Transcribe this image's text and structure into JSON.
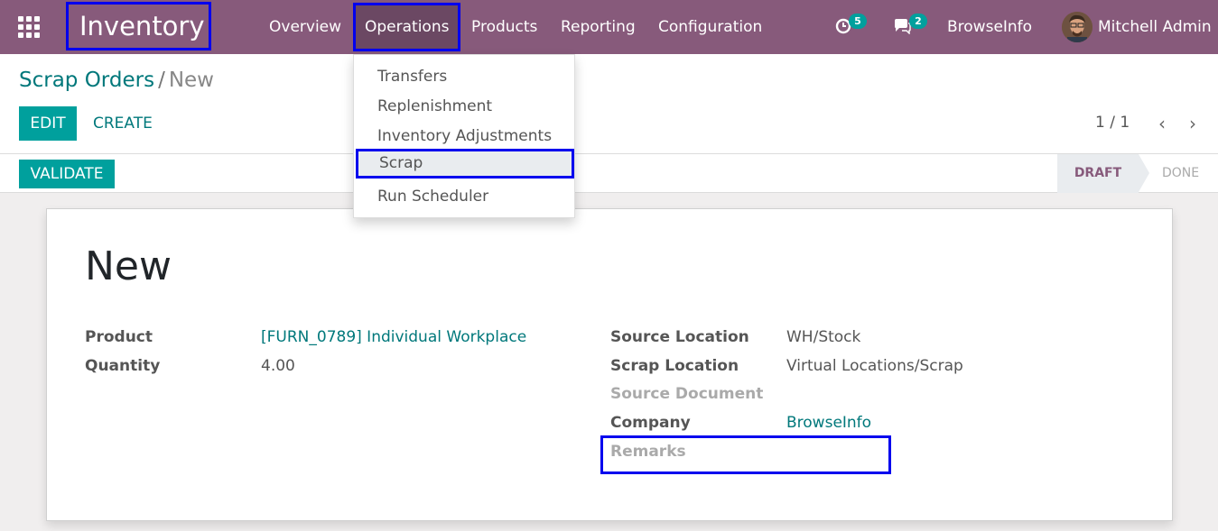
{
  "navbar": {
    "app_name": "Inventory",
    "menus": [
      "Overview",
      "Operations",
      "Products",
      "Reporting",
      "Configuration"
    ],
    "activity_count": "5",
    "message_count": "2",
    "company": "BrowseInfo",
    "user": "Mitchell Admin",
    "icons": {
      "apps": "apps-grid-icon",
      "activity": "clock-icon",
      "messages": "chat-icon"
    }
  },
  "dropdown": {
    "items": [
      "Transfers",
      "Replenishment",
      "Inventory Adjustments",
      "Scrap",
      "Run Scheduler"
    ],
    "highlighted": "Scrap"
  },
  "breadcrumb": {
    "parent": "Scrap Orders",
    "separator": "/",
    "current": "New"
  },
  "toolbar": {
    "edit_label": "EDIT",
    "create_label": "CREATE",
    "pager": "1 / 1"
  },
  "statusbar": {
    "validate_label": "VALIDATE",
    "stages": [
      "DRAFT",
      "DONE"
    ],
    "active_stage": "DRAFT"
  },
  "form": {
    "title": "New",
    "product_label": "Product",
    "product_value": "[FURN_0789] Individual Workplace",
    "quantity_label": "Quantity",
    "quantity_value": "4.00",
    "source_location_label": "Source Location",
    "source_location_value": "WH/Stock",
    "scrap_location_label": "Scrap Location",
    "scrap_location_value": "Virtual Locations/Scrap",
    "source_document_label": "Source Document",
    "company_label": "Company",
    "company_value": "BrowseInfo",
    "remarks_label": "Remarks"
  },
  "colors": {
    "navbar": "#875a7b",
    "accent": "#00a09d",
    "link": "#00787b",
    "highlight_border": "#0000ee"
  }
}
